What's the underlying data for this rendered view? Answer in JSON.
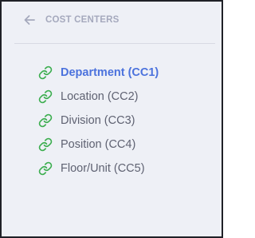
{
  "header": {
    "back_icon": "arrow-left-icon",
    "title": "COST CENTERS"
  },
  "menu": {
    "icon": "link-icon",
    "icon_color": "#3dae50",
    "active_color": "#4b72dd",
    "items": [
      {
        "label": "Department (CC1)",
        "active": true
      },
      {
        "label": "Location (CC2)",
        "active": false
      },
      {
        "label": "Division (CC3)",
        "active": false
      },
      {
        "label": "Position (CC4)",
        "active": false
      },
      {
        "label": "Floor/Unit (CC5)",
        "active": false
      }
    ]
  }
}
